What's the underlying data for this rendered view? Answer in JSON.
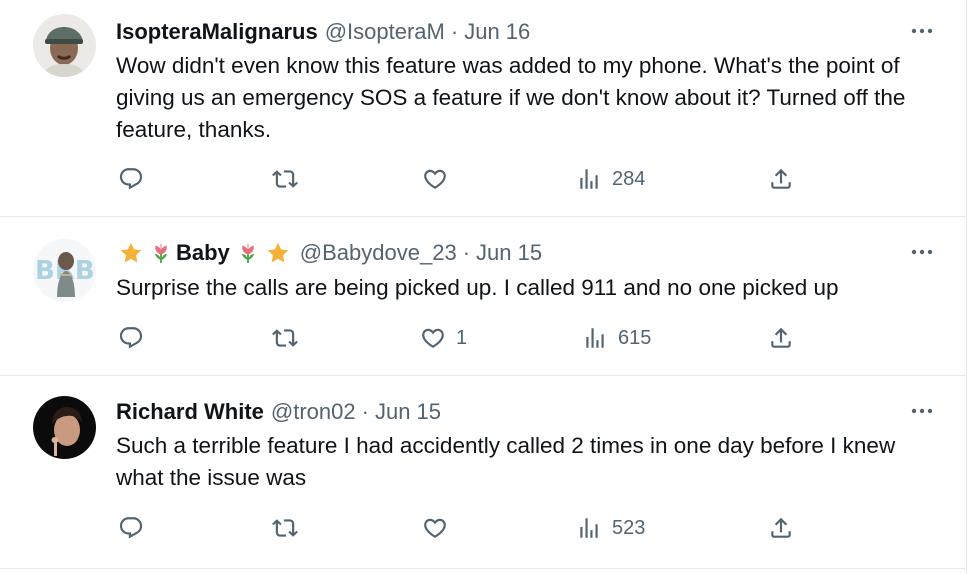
{
  "tweets": [
    {
      "name": "IsopteraMalignarus",
      "handle": "@IsopteraM",
      "separator": "·",
      "time": "Jun 16",
      "text": "Wow didn't even know this feature was added to my phone. What's the point of giving us an emergency SOS a feature if we don't know about it? Turned off the feature, thanks.",
      "replies": "",
      "reposts": "",
      "likes": "",
      "views": "284"
    },
    {
      "name": "Baby",
      "name_emojis": [
        "star-emoji",
        "tulip-emoji",
        "tulip-emoji",
        "star-emoji"
      ],
      "handle": "@Babydove_23",
      "separator": "·",
      "time": "Jun 15",
      "text": "Surprise the calls are being picked up. I called 911 and no one picked up",
      "replies": "",
      "reposts": "",
      "likes": "1",
      "views": "615"
    },
    {
      "name": "Richard White",
      "handle": "@tron02",
      "separator": "·",
      "time": "Jun 15",
      "text": "Such a terrible feature I had accidently called 2 times in one day before I knew what the issue was",
      "replies": "",
      "reposts": "",
      "likes": "",
      "views": "523"
    }
  ],
  "icons": {
    "more": "more-dots-icon",
    "reply": "reply-icon",
    "repost": "repost-icon",
    "like": "like-icon",
    "views": "views-icon",
    "share": "share-icon"
  },
  "colors": {
    "text": "#0f1419",
    "secondary": "#536471",
    "divider": "#e7e9ea",
    "star": "#f4b23a",
    "tulip": "#e8707e",
    "leaf": "#4fa34a"
  }
}
